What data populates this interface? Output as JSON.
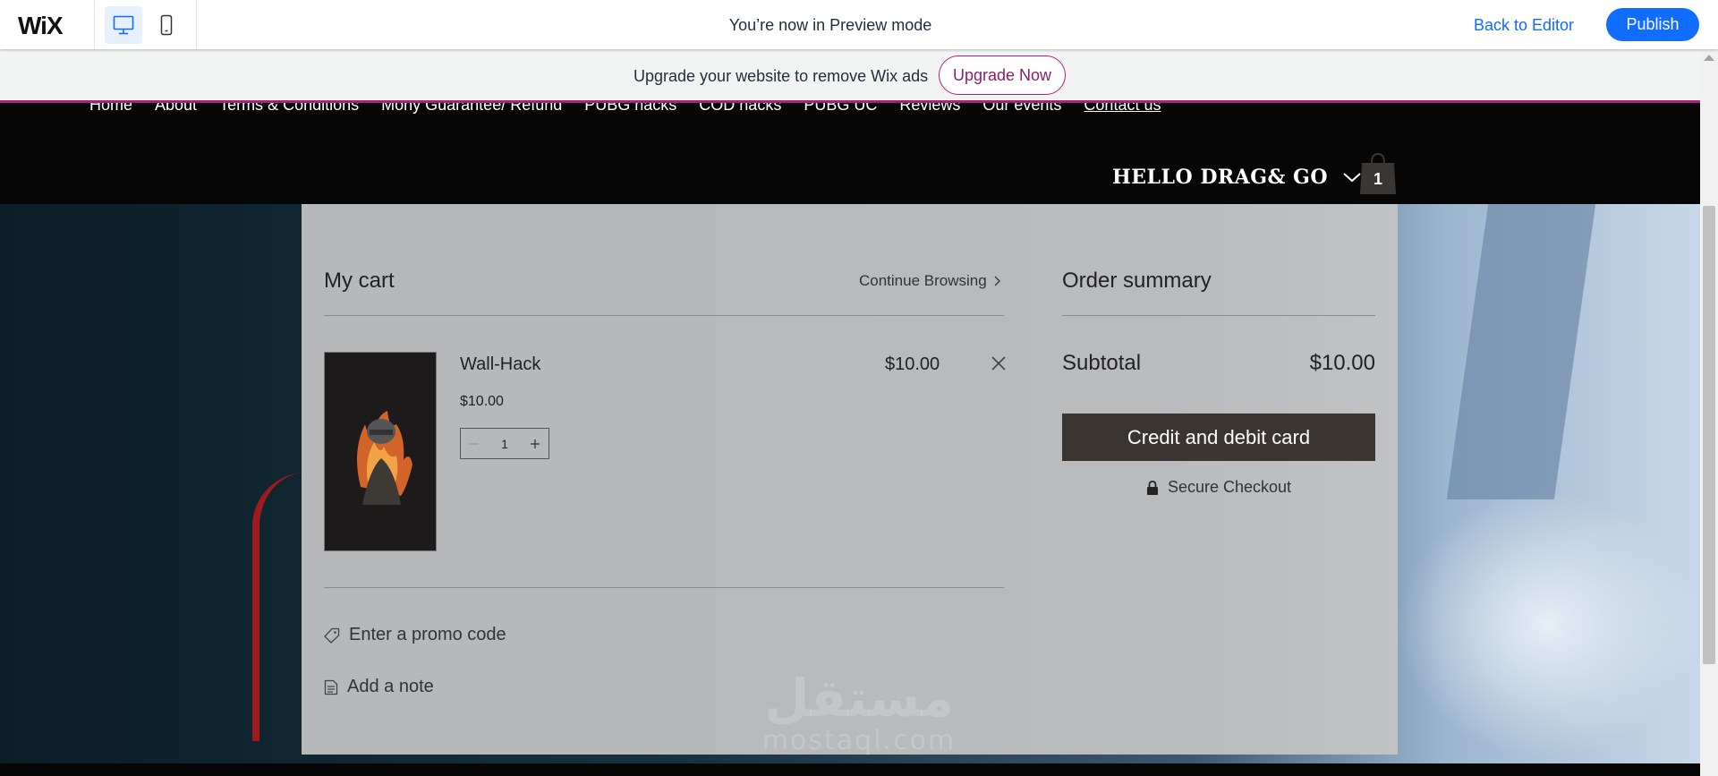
{
  "topbar": {
    "logo": "WiX",
    "preview_message": "You’re now in Preview mode",
    "back_to_editor": "Back to Editor",
    "publish": "Publish",
    "icons": {
      "desktop": "desktop-icon",
      "mobile": "mobile-icon"
    }
  },
  "ad_banner": {
    "text": "Upgrade your website to remove Wix ads",
    "button": "Upgrade Now",
    "accent_color": "#a6227c"
  },
  "site_header": {
    "nav": [
      "Home",
      "About",
      "Terms & Conditions",
      "Mony Guarantee/ Refund",
      "PUBG hacks",
      "COD hacks",
      "PUBG UC",
      "Reviews",
      "Our events",
      "Contact us"
    ],
    "active_nav": "Contact us",
    "account_name": "HELLO DRAG& GO",
    "cart_count": "1"
  },
  "cart": {
    "title": "My cart",
    "continue_browsing": "Continue Browsing",
    "items": [
      {
        "name": "Wall-Hack",
        "unit_price": "$10.00",
        "quantity": "1",
        "line_total": "$10.00"
      }
    ],
    "promo_link": "Enter a promo code",
    "note_link": "Add a note"
  },
  "summary": {
    "title": "Order summary",
    "subtotal_label": "Subtotal",
    "subtotal_value": "$10.00",
    "checkout_button": "Credit and debit card",
    "secure_checkout": "Secure Checkout",
    "button_color": "#3b3532"
  },
  "watermark": {
    "arabic": "مستقل",
    "latin": "mostaql.com"
  },
  "colors": {
    "wix_blue": "#116dff"
  }
}
